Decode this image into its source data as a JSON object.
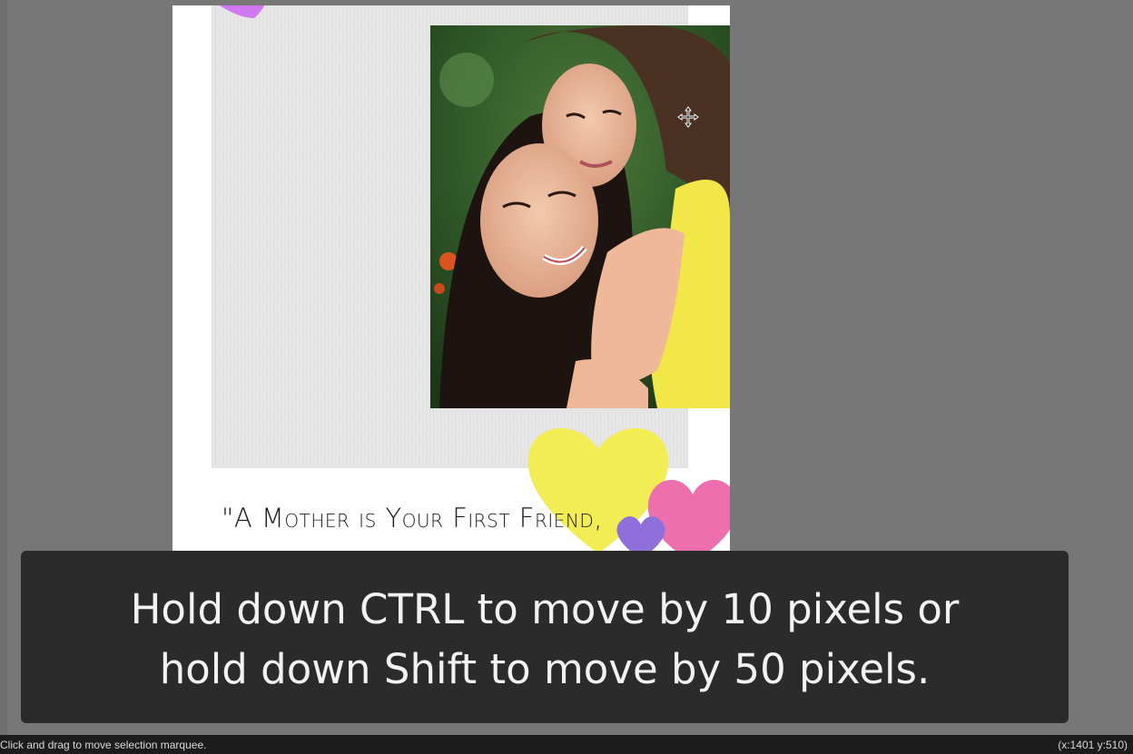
{
  "document": {
    "quote_line1": "\"A Mother is Your First Friend,"
  },
  "caption": {
    "line1": "Hold down CTRL to move by 10 pixels or",
    "line2": "hold down Shift to move by 50 pixels."
  },
  "status_bar": {
    "hint": "Click and drag to move selection marquee.",
    "cursor_readout": "(x:1401 y:510)"
  },
  "colors": {
    "workspace": "#777777",
    "caption_bg": "#2b2b2b",
    "heart_yellow": "#f2ec55",
    "heart_pink": "#ee6fae",
    "heart_purple": "#8f6fd9",
    "heart_violet": "#cf78f0"
  },
  "icons": {
    "cursor": "move-cursor-icon"
  }
}
